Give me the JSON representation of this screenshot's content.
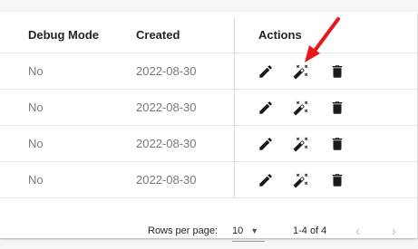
{
  "table": {
    "columns": {
      "debug_mode": "Debug Mode",
      "created": "Created",
      "actions": "Actions"
    },
    "rows": [
      {
        "debug_mode": "No",
        "created": "2022-08-30"
      },
      {
        "debug_mode": "No",
        "created": "2022-08-30"
      },
      {
        "debug_mode": "No",
        "created": "2022-08-30"
      },
      {
        "debug_mode": "No",
        "created": "2022-08-30"
      }
    ],
    "row_icons": [
      "edit-icon",
      "magic-wand-icon",
      "delete-icon"
    ]
  },
  "pagination": {
    "rows_per_page_label": "Rows per page:",
    "rows_per_page_value": "10",
    "range_label": "1-4 of 4",
    "prev_symbol": "‹",
    "next_symbol": "›"
  },
  "annotation": {
    "color": "#e8171b"
  }
}
